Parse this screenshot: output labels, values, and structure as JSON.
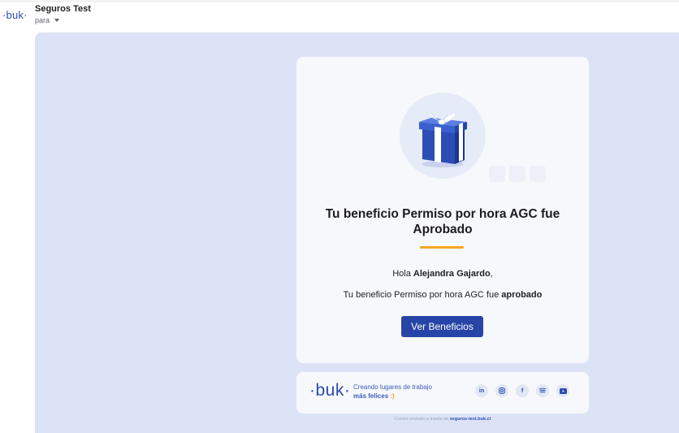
{
  "sender": {
    "logo": "buk",
    "name": "Seguros Test",
    "recipient_label": "para"
  },
  "email": {
    "headline": "Tu beneficio Permiso por hora AGC fue Aprobado",
    "greeting_prefix": "Hola ",
    "recipient_name": "Alejandra Gajardo",
    "greeting_suffix": ",",
    "message_prefix": "Tu beneficio Permiso por hora AGC fue ",
    "message_status": "aprobado",
    "cta_label": "Ver Beneficios"
  },
  "footer": {
    "logo": "buk",
    "tagline_line1": "Creando lugares de trabajo",
    "tagline_line2": "más felices",
    "tagline_emoji": ":)",
    "socials": [
      {
        "icon": "linkedin-icon",
        "glyph": "in"
      },
      {
        "icon": "instagram-icon",
        "glyph": ""
      },
      {
        "icon": "facebook-icon",
        "glyph": "f"
      },
      {
        "icon": "spotify-icon",
        "glyph": ""
      },
      {
        "icon": "youtube-icon",
        "glyph": ""
      }
    ],
    "sent_prefix": "Correo enviado a través de",
    "sent_domain": "seguros-test.buk.cl"
  },
  "colors": {
    "brand": "#2a4cb0",
    "accent": "#f5a623",
    "button": "#2745a6",
    "background": "#dce3f6"
  }
}
